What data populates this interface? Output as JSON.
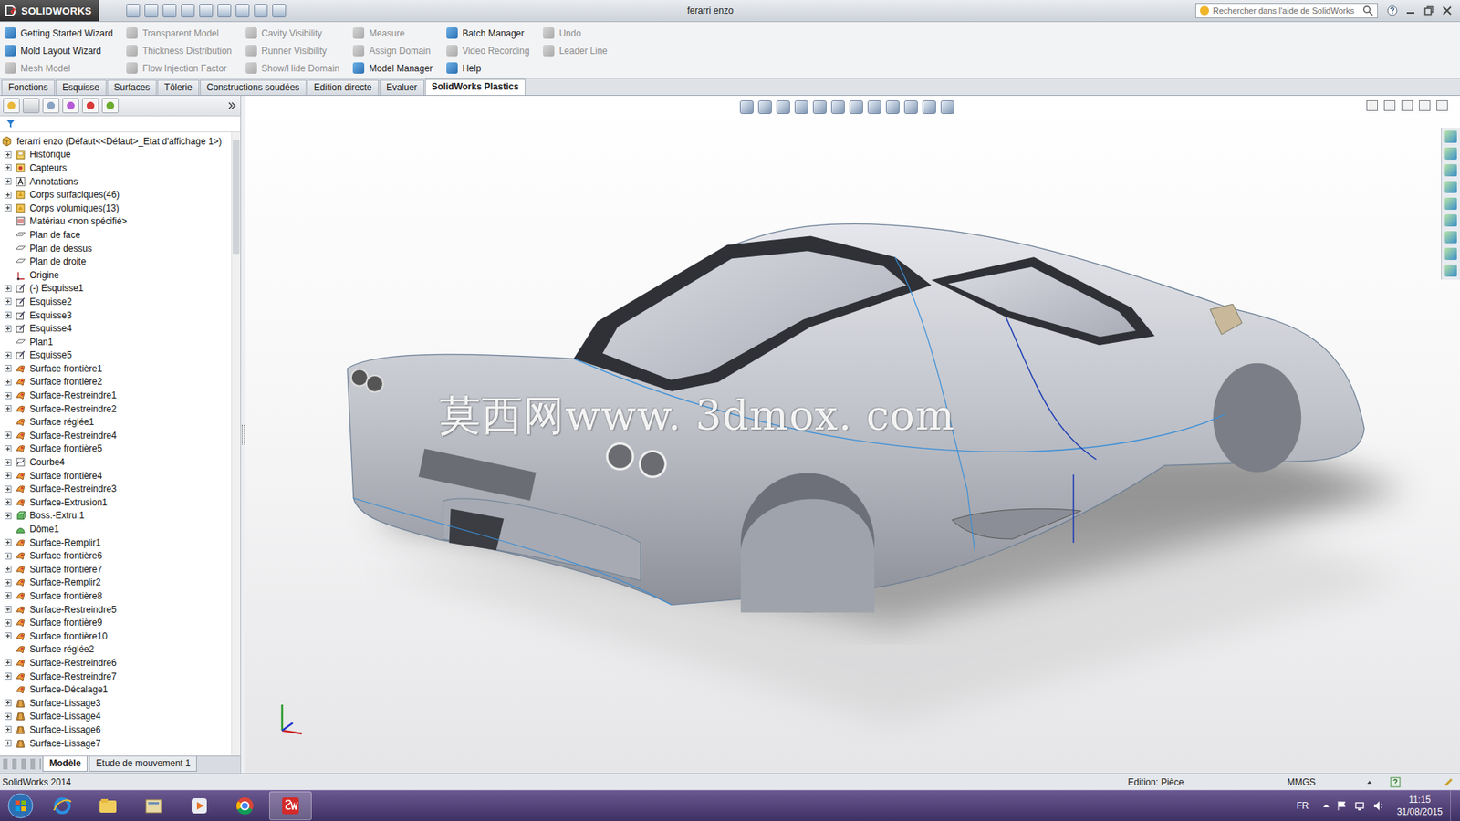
{
  "window": {
    "app": "SOLIDWORKS",
    "title": "ferarri enzo"
  },
  "search": {
    "placeholder": "Rechercher dans l'aide de SolidWorks"
  },
  "command_columns": [
    [
      {
        "label": "Getting Started Wizard",
        "disabled": false
      },
      {
        "label": "Mold Layout Wizard",
        "disabled": false
      },
      {
        "label": "Mesh Model",
        "disabled": true
      }
    ],
    [
      {
        "label": "Transparent Model",
        "disabled": true
      },
      {
        "label": "Thickness Distribution",
        "disabled": true
      },
      {
        "label": "Flow Injection Factor",
        "disabled": true
      }
    ],
    [
      {
        "label": "Cavity Visibility",
        "disabled": true
      },
      {
        "label": "Runner Visibility",
        "disabled": true
      },
      {
        "label": "Show/Hide Domain",
        "disabled": true
      }
    ],
    [
      {
        "label": "Measure",
        "disabled": true
      },
      {
        "label": "Assign Domain",
        "disabled": true
      },
      {
        "label": "Model Manager",
        "disabled": false
      }
    ],
    [
      {
        "label": "Batch Manager",
        "disabled": false
      },
      {
        "label": "Video Recording",
        "disabled": true
      },
      {
        "label": "Help",
        "disabled": false
      }
    ],
    [
      {
        "label": "Undo",
        "disabled": true
      },
      {
        "label": "Leader Line",
        "disabled": true
      }
    ]
  ],
  "tabs": [
    {
      "label": "Fonctions",
      "selected": false
    },
    {
      "label": "Esquisse",
      "selected": false
    },
    {
      "label": "Surfaces",
      "selected": false
    },
    {
      "label": "Tôlerie",
      "selected": false
    },
    {
      "label": "Constructions soudées",
      "selected": false
    },
    {
      "label": "Edition directe",
      "selected": false
    },
    {
      "label": "Evaluer",
      "selected": false
    },
    {
      "label": "SolidWorks Plastics",
      "selected": true
    }
  ],
  "tree": {
    "root": "ferarri enzo  (Défaut<<Défaut>_Etat d'affichage 1>)",
    "items": [
      {
        "label": "Historique",
        "kind": "folder",
        "has_children": true
      },
      {
        "label": "Capteurs",
        "kind": "sensor",
        "has_children": true
      },
      {
        "label": "Annotations",
        "kind": "annotation",
        "has_children": true
      },
      {
        "label": "Corps surfaciques(46)",
        "kind": "body",
        "has_children": true
      },
      {
        "label": "Corps volumiques(13)",
        "kind": "body",
        "has_children": true
      },
      {
        "label": "Matériau <non spécifié>",
        "kind": "material",
        "has_children": false
      },
      {
        "label": "Plan de face",
        "kind": "plane",
        "has_children": false
      },
      {
        "label": "Plan de dessus",
        "kind": "plane",
        "has_children": false
      },
      {
        "label": "Plan de droite",
        "kind": "plane",
        "has_children": false
      },
      {
        "label": "Origine",
        "kind": "origin",
        "has_children": false
      },
      {
        "label": "(-) Esquisse1",
        "kind": "sketch",
        "has_children": true
      },
      {
        "label": "Esquisse2",
        "kind": "sketch",
        "has_children": true
      },
      {
        "label": "Esquisse3",
        "kind": "sketch",
        "has_children": true
      },
      {
        "label": "Esquisse4",
        "kind": "sketch",
        "has_children": true
      },
      {
        "label": "Plan1",
        "kind": "plane",
        "has_children": false
      },
      {
        "label": "Esquisse5",
        "kind": "sketch",
        "has_children": true
      },
      {
        "label": "Surface frontière1",
        "kind": "surface",
        "has_children": true
      },
      {
        "label": "Surface frontière2",
        "kind": "surface",
        "has_children": true
      },
      {
        "label": "Surface-Restreindre1",
        "kind": "surface",
        "has_children": true
      },
      {
        "label": "Surface-Restreindre2",
        "kind": "surface",
        "has_children": true
      },
      {
        "label": "Surface réglée1",
        "kind": "surface",
        "has_children": false
      },
      {
        "label": "Surface-Restreindre4",
        "kind": "surface",
        "has_children": true
      },
      {
        "label": "Surface frontière5",
        "kind": "surface",
        "has_children": true
      },
      {
        "label": "Courbe4",
        "kind": "curve",
        "has_children": true
      },
      {
        "label": "Surface frontière4",
        "kind": "surface",
        "has_children": true
      },
      {
        "label": "Surface-Restreindre3",
        "kind": "surface",
        "has_children": true
      },
      {
        "label": "Surface-Extrusion1",
        "kind": "surface",
        "has_children": true
      },
      {
        "label": "Boss.-Extru.1",
        "kind": "boss",
        "has_children": true
      },
      {
        "label": "Dôme1",
        "kind": "dome",
        "has_children": false
      },
      {
        "label": "Surface-Remplir1",
        "kind": "surface",
        "has_children": true
      },
      {
        "label": "Surface frontière6",
        "kind": "surface",
        "has_children": true
      },
      {
        "label": "Surface frontière7",
        "kind": "surface",
        "has_children": true
      },
      {
        "label": "Surface-Remplir2",
        "kind": "surface",
        "has_children": true
      },
      {
        "label": "Surface frontière8",
        "kind": "surface",
        "has_children": true
      },
      {
        "label": "Surface-Restreindre5",
        "kind": "surface",
        "has_children": true
      },
      {
        "label": "Surface frontière9",
        "kind": "surface",
        "has_children": true
      },
      {
        "label": "Surface frontière10",
        "kind": "surface",
        "has_children": true
      },
      {
        "label": "Surface réglée2",
        "kind": "surface",
        "has_children": false
      },
      {
        "label": "Surface-Restreindre6",
        "kind": "surface",
        "has_children": true
      },
      {
        "label": "Surface-Restreindre7",
        "kind": "surface",
        "has_children": true
      },
      {
        "label": "Surface-Décalage1",
        "kind": "surface",
        "has_children": false
      },
      {
        "label": "Surface-Lissage3",
        "kind": "loft",
        "has_children": true
      },
      {
        "label": "Surface-Lissage4",
        "kind": "loft",
        "has_children": true
      },
      {
        "label": "Surface-Lissage6",
        "kind": "loft",
        "has_children": true
      },
      {
        "label": "Surface-Lissage7",
        "kind": "loft",
        "has_children": true
      }
    ]
  },
  "bottom_tabs": [
    {
      "label": "Modèle",
      "selected": true
    },
    {
      "label": "Etude de mouvement 1",
      "selected": false
    }
  ],
  "watermark": "莫西网www. 3dmox. com",
  "status_bar": {
    "version": "SolidWorks 2014",
    "mode": "Edition: Pièce",
    "units": "MMGS"
  },
  "taskbar": {
    "language": "FR",
    "time": "11:15",
    "date": "31/08/2015"
  }
}
